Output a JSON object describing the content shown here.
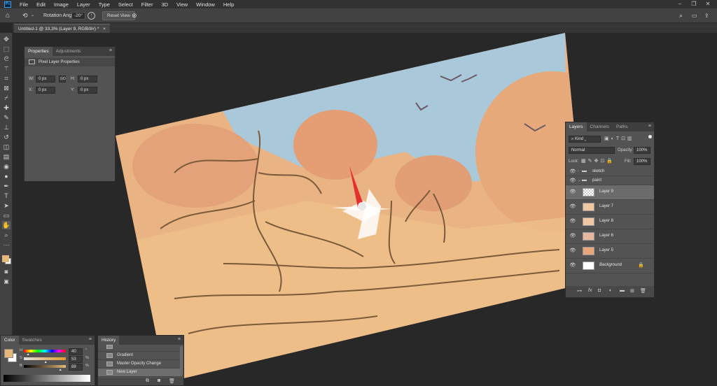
{
  "menubar": {
    "items": [
      "File",
      "Edit",
      "Image",
      "Layer",
      "Type",
      "Select",
      "Filter",
      "3D",
      "View",
      "Window",
      "Help"
    ]
  },
  "options": {
    "rotation_label": "Rotation Angle:",
    "rotation_value": "-20°",
    "reset_view_label": "Reset View"
  },
  "document": {
    "tab_title": "Untitled-1 @ 33,3% (Layer 9, RGB/8#) *",
    "tab_close": "×"
  },
  "properties": {
    "tabs": [
      "Properties",
      "Adjustments"
    ],
    "section_label": "Pixel Layer Properties",
    "w_label": "W:",
    "w_value": "0 px",
    "h_label": "H:",
    "h_value": "0 px",
    "x_label": "X:",
    "x_value": "0 px",
    "y_label": "Y:",
    "y_value": "0 px",
    "link_label": "GO"
  },
  "layers": {
    "tabs": [
      "Layers",
      "Channels",
      "Paths"
    ],
    "kind_label": "Kind",
    "blend_mode": "Normal",
    "opacity_label": "Opacity:",
    "opacity_value": "100%",
    "lock_label": "Lock:",
    "fill_label": "Fill:",
    "fill_value": "100%",
    "folders": [
      "sketch",
      "paint"
    ],
    "rows": [
      {
        "name": "Layer 9"
      },
      {
        "name": "Layer 7"
      },
      {
        "name": "Layer 8"
      },
      {
        "name": "Layer 6"
      },
      {
        "name": "Layer 5"
      },
      {
        "name": "Background"
      }
    ]
  },
  "color": {
    "tabs": [
      "Color",
      "Swatches"
    ],
    "h_label": "H",
    "h_value": "40",
    "s_label": "S",
    "s_value": "53",
    "b_label": "B",
    "b_value": "88",
    "h_unit": "°",
    "s_unit": "%",
    "b_unit": "%",
    "h_fraction": 0.11,
    "s_fraction": 0.53,
    "b_fraction": 0.88,
    "foreground": "#e3b87a",
    "background": "#ffffff"
  },
  "history": {
    "title": "History",
    "rows": [
      {
        "name": "Gradient"
      },
      {
        "name": "Master Opacity Change"
      },
      {
        "name": "New Layer"
      }
    ]
  },
  "colors": {
    "accent": "#31a8ff",
    "sky": "#a7c7da",
    "paint_orange": "#eab17e",
    "sketch_line": "#7a5a3a",
    "compass_needle": "#e53030"
  }
}
